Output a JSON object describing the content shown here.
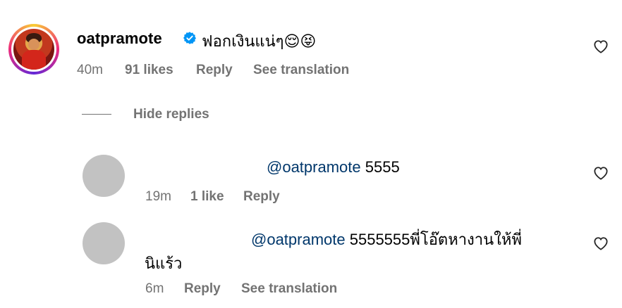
{
  "main_comment": {
    "username": "oatpramote",
    "text": "ฟอกเงินแน่ๆ😌😝",
    "time": "40m",
    "likes": "91 likes",
    "reply_label": "Reply",
    "translate_label": "See translation"
  },
  "hide_replies_label": "Hide replies",
  "replies": [
    {
      "mention": "@oatpramote",
      "text": " 5555",
      "time": "19m",
      "likes": "1 like",
      "reply_label": "Reply"
    },
    {
      "mention": "@oatpramote",
      "text": " 5555555พี่โอ๊ตหางานให้พี่",
      "text_line2": "นิแร้ว",
      "time": "6m",
      "reply_label": "Reply",
      "translate_label": "See translation"
    }
  ],
  "colors": {
    "meta_gray": "#737373",
    "mention_blue": "#00376b",
    "verified_blue": "#0095f6"
  },
  "icons": {
    "verified": "verified-badge-icon",
    "like": "heart-outline-icon"
  }
}
